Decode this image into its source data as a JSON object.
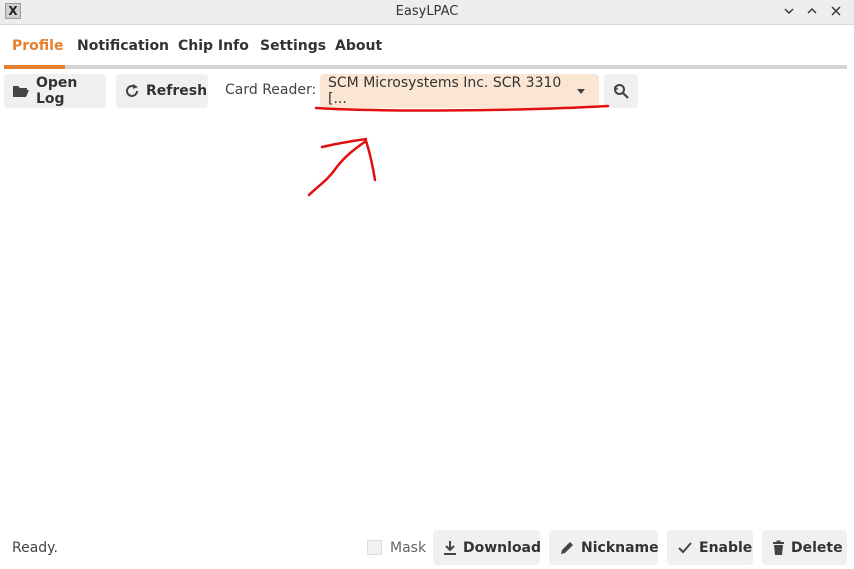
{
  "window": {
    "title": "EasyLPAC",
    "app_icon_glyph": "X",
    "controls": [
      "minimize",
      "maximize",
      "close"
    ]
  },
  "tabs": [
    {
      "label": "Profile",
      "active": true
    },
    {
      "label": "Notification",
      "active": false
    },
    {
      "label": "Chip Info",
      "active": false
    },
    {
      "label": "Settings",
      "active": false
    },
    {
      "label": "About",
      "active": false
    }
  ],
  "toolbar": {
    "open_log_label": "Open Log",
    "open_log_icon": "folder-open-icon",
    "refresh_label": "Refresh",
    "refresh_icon": "refresh-icon",
    "card_reader_label": "Card Reader:",
    "card_reader_value": "SCM Microsystems Inc. SCR 3310 [...",
    "scan_icon": "scan-refresh-icon"
  },
  "annotation": {
    "type": "hand-drawn underline and arrow",
    "color": "#e01010"
  },
  "footer": {
    "status": "Ready.",
    "mask_label": "Mask",
    "mask_checked": false,
    "download_label": "Download",
    "nickname_label": "Nickname",
    "enable_label": "Enable",
    "delete_label": "Delete"
  },
  "colors": {
    "accent": "#e57f2c",
    "select_bg": "#fbe6d3",
    "button_bg": "#f0f0f0",
    "annotation": "#e01010"
  }
}
